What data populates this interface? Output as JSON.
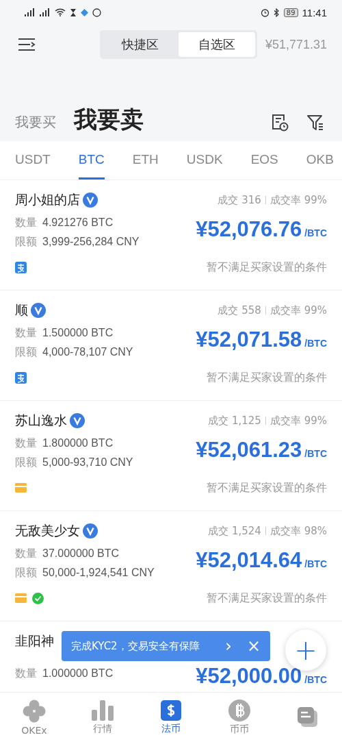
{
  "status_bar": {
    "battery": "89",
    "time": "11:41"
  },
  "header": {
    "segments": [
      {
        "label": "快捷区",
        "selected": false
      },
      {
        "label": "自选区",
        "selected": true
      }
    ],
    "index_price": "¥51,771.31"
  },
  "modes": [
    {
      "label": "我要买",
      "selected": false
    },
    {
      "label": "我要卖",
      "selected": true
    }
  ],
  "currency_tabs": [
    {
      "label": "USDT",
      "selected": false
    },
    {
      "label": "BTC",
      "selected": true
    },
    {
      "label": "ETH",
      "selected": false
    },
    {
      "label": "USDK",
      "selected": false
    },
    {
      "label": "EOS",
      "selected": false
    },
    {
      "label": "OKB",
      "selected": false
    }
  ],
  "listings": [
    {
      "name": "周小姐的店",
      "verified": true,
      "trades": "成交 316",
      "rate": "成交率 99%",
      "quantity_label": "数量",
      "quantity": "4.921276 BTC",
      "limit_label": "限额",
      "limit": "3,999-256,284 CNY",
      "price": "¥52,076.76",
      "unit": "/BTC",
      "payments": [
        {
          "kind": "alipay"
        }
      ],
      "notice": "暂不满足买家设置的条件"
    },
    {
      "name": "顺",
      "verified": true,
      "trades": "成交 558",
      "rate": "成交率 99%",
      "quantity_label": "数量",
      "quantity": "1.500000 BTC",
      "limit_label": "限额",
      "limit": "4,000-78,107 CNY",
      "price": "¥52,071.58",
      "unit": "/BTC",
      "payments": [
        {
          "kind": "alipay"
        }
      ],
      "notice": "暂不满足买家设置的条件"
    },
    {
      "name": "苏山逸水",
      "verified": true,
      "trades": "成交 1,125",
      "rate": "成交率 99%",
      "quantity_label": "数量",
      "quantity": "1.800000 BTC",
      "limit_label": "限额",
      "limit": "5,000-93,710 CNY",
      "price": "¥52,061.23",
      "unit": "/BTC",
      "payments": [
        {
          "kind": "card"
        }
      ],
      "notice": "暂不满足买家设置的条件"
    },
    {
      "name": "无敌美少女",
      "verified": true,
      "trades": "成交 1,524",
      "rate": "成交率 98%",
      "quantity_label": "数量",
      "quantity": "37.000000 BTC",
      "limit_label": "限额",
      "limit": "50,000-1,924,541 CNY",
      "price": "¥52,014.64",
      "unit": "/BTC",
      "payments": [
        {
          "kind": "card"
        },
        {
          "kind": "wechat"
        }
      ],
      "notice": "暂不满足买家设置的条件"
    },
    {
      "name": "韭阳神",
      "quantity_label": "数量",
      "quantity": "1.000000 BTC",
      "price": "¥52,000.00",
      "unit": "/BTC"
    }
  ],
  "banner": {
    "text": "完成KYC2，交易安全有保障",
    "arrow": "›",
    "close": "×"
  },
  "fab": {
    "label": "+"
  },
  "bottom_nav": [
    {
      "label": "OKEx",
      "selected": false
    },
    {
      "label": "行情",
      "selected": false
    },
    {
      "label": "法币",
      "selected": true
    },
    {
      "label": "币币",
      "selected": false
    },
    {
      "selected": false
    }
  ]
}
